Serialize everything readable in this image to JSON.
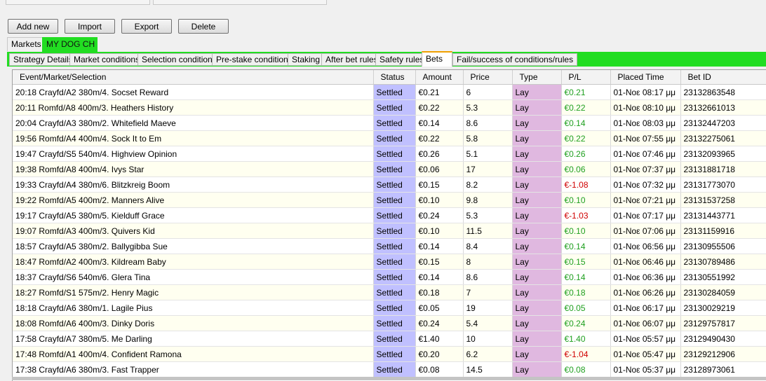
{
  "toolbar": {
    "add_new": "Add new",
    "import": "Import",
    "export": "Export",
    "delete": "Delete"
  },
  "outer_tabs": {
    "markets": "Markets",
    "my_dog": "MY DOG CH"
  },
  "inner_tabs": [
    "Strategy Details",
    "Market conditions",
    "Selection conditions",
    "Pre-stake conditions",
    "Staking",
    "After bet rules",
    "Safety rules",
    "Bets",
    "Fail/success of conditions/rules"
  ],
  "active_inner_tab": "Bets",
  "colors": {
    "accent_green": "#22dd22",
    "status_bg": "#c0c0ff",
    "type_bg": "#e0b8e0",
    "profit": "#20a020",
    "loss": "#d00000"
  },
  "bets_table": {
    "columns": [
      "Event/Market/Selection",
      "Status",
      "Amount",
      "Price",
      "Type",
      "P/L",
      "Placed Time",
      "Bet ID"
    ],
    "rows": [
      [
        "20:18 Crayfd/A2 380m/4. Socset Reward",
        "Settled",
        "€0.21",
        "6",
        "Lay",
        "€0.21",
        "01-Νοε 08:17 μμ",
        "23132863548"
      ],
      [
        "20:11 Romfd/A8 400m/3. Heathers History",
        "Settled",
        "€0.22",
        "5.3",
        "Lay",
        "€0.22",
        "01-Νοε 08:10 μμ",
        "23132661013"
      ],
      [
        "20:04 Crayfd/A3 380m/2. Whitefield Maeve",
        "Settled",
        "€0.14",
        "8.6",
        "Lay",
        "€0.14",
        "01-Νοε 08:03 μμ",
        "23132447203"
      ],
      [
        "19:56 Romfd/A4 400m/4. Sock It to Em",
        "Settled",
        "€0.22",
        "5.8",
        "Lay",
        "€0.22",
        "01-Νοε 07:55 μμ",
        "23132275061"
      ],
      [
        "19:47 Crayfd/S5 540m/4. Highview Opinion",
        "Settled",
        "€0.26",
        "5.1",
        "Lay",
        "€0.26",
        "01-Νοε 07:46 μμ",
        "23132093965"
      ],
      [
        "19:38 Romfd/A8 400m/4. Ivys Star",
        "Settled",
        "€0.06",
        "17",
        "Lay",
        "€0.06",
        "01-Νοε 07:37 μμ",
        "23131881718"
      ],
      [
        "19:33 Crayfd/A4 380m/6. Blitzkreig Boom",
        "Settled",
        "€0.15",
        "8.2",
        "Lay",
        "€-1.08",
        "01-Νοε 07:32 μμ",
        "23131773070"
      ],
      [
        "19:22 Romfd/A5 400m/2. Manners Alive",
        "Settled",
        "€0.10",
        "9.8",
        "Lay",
        "€0.10",
        "01-Νοε 07:21 μμ",
        "23131537258"
      ],
      [
        "19:17 Crayfd/A5 380m/5. Kielduff Grace",
        "Settled",
        "€0.24",
        "5.3",
        "Lay",
        "€-1.03",
        "01-Νοε 07:17 μμ",
        "23131443771"
      ],
      [
        "19:07 Romfd/A3 400m/3. Quivers Kid",
        "Settled",
        "€0.10",
        "11.5",
        "Lay",
        "€0.10",
        "01-Νοε 07:06 μμ",
        "23131159916"
      ],
      [
        "18:57 Crayfd/A5 380m/2. Ballygibba Sue",
        "Settled",
        "€0.14",
        "8.4",
        "Lay",
        "€0.14",
        "01-Νοε 06:56 μμ",
        "23130955506"
      ],
      [
        "18:47 Romfd/A2 400m/3. Kildream Baby",
        "Settled",
        "€0.15",
        "8",
        "Lay",
        "€0.15",
        "01-Νοε 06:46 μμ",
        "23130789486"
      ],
      [
        "18:37 Crayfd/S6 540m/6. Glera Tina",
        "Settled",
        "€0.14",
        "8.6",
        "Lay",
        "€0.14",
        "01-Νοε 06:36 μμ",
        "23130551992"
      ],
      [
        "18:27 Romfd/S1 575m/2. Henry Magic",
        "Settled",
        "€0.18",
        "7",
        "Lay",
        "€0.18",
        "01-Νοε 06:26 μμ",
        "23130284059"
      ],
      [
        "18:18 Crayfd/A6 380m/1. Lagile Pius",
        "Settled",
        "€0.05",
        "19",
        "Lay",
        "€0.05",
        "01-Νοε 06:17 μμ",
        "23130029219"
      ],
      [
        "18:08 Romfd/A6 400m/3. Dinky Doris",
        "Settled",
        "€0.24",
        "5.4",
        "Lay",
        "€0.24",
        "01-Νοε 06:07 μμ",
        "23129757817"
      ],
      [
        "17:58 Crayfd/A7 380m/5. Me Darling",
        "Settled",
        "€1.40",
        "10",
        "Lay",
        "€1.40",
        "01-Νοε 05:57 μμ",
        "23129490430"
      ],
      [
        "17:48 Romfd/A1 400m/4. Confident Ramona",
        "Settled",
        "€0.20",
        "6.2",
        "Lay",
        "€-1.04",
        "01-Νοε 05:47 μμ",
        "23129212906"
      ],
      [
        "17:38 Crayfd/A6 380m/3. Fast Trapper",
        "Settled",
        "€0.08",
        "14.5",
        "Lay",
        "€0.08",
        "01-Νοε 05:37 μμ",
        "23128973061"
      ]
    ]
  }
}
